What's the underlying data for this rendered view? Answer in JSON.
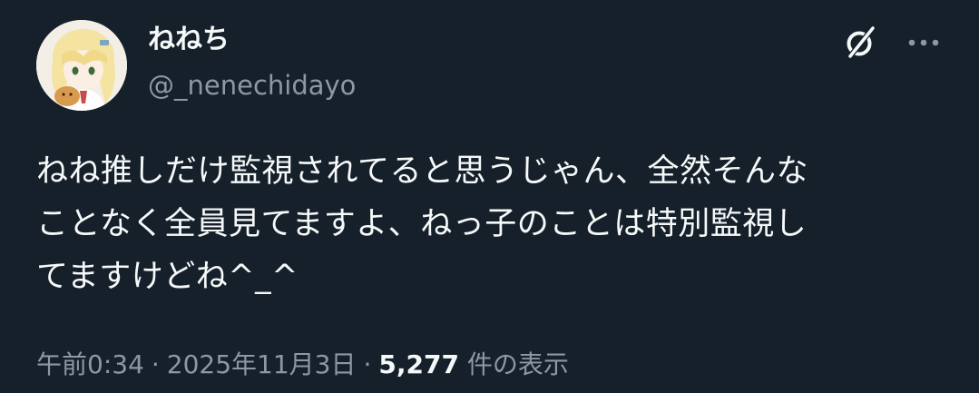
{
  "author": {
    "display_name": "ねねち",
    "handle": "@_nenechidayo"
  },
  "tweet": {
    "text_lines": [
      "ねね推しだけ監視されてると思うじゃん、全然そんな",
      "ことなく全員見てますよ、ねっ子のことは特別監視し",
      "てますけどね^_^"
    ]
  },
  "meta": {
    "time": "午前0:34",
    "separator": "·",
    "date": "2025年11月3日",
    "views_count": "5,277",
    "views_label": "件の表示"
  },
  "icons": {
    "grok": "grok-icon",
    "more": "more-options-icon"
  },
  "colors": {
    "background": "#15202b",
    "primary_text": "#f7f9f9",
    "secondary_text": "#8b98a5"
  }
}
